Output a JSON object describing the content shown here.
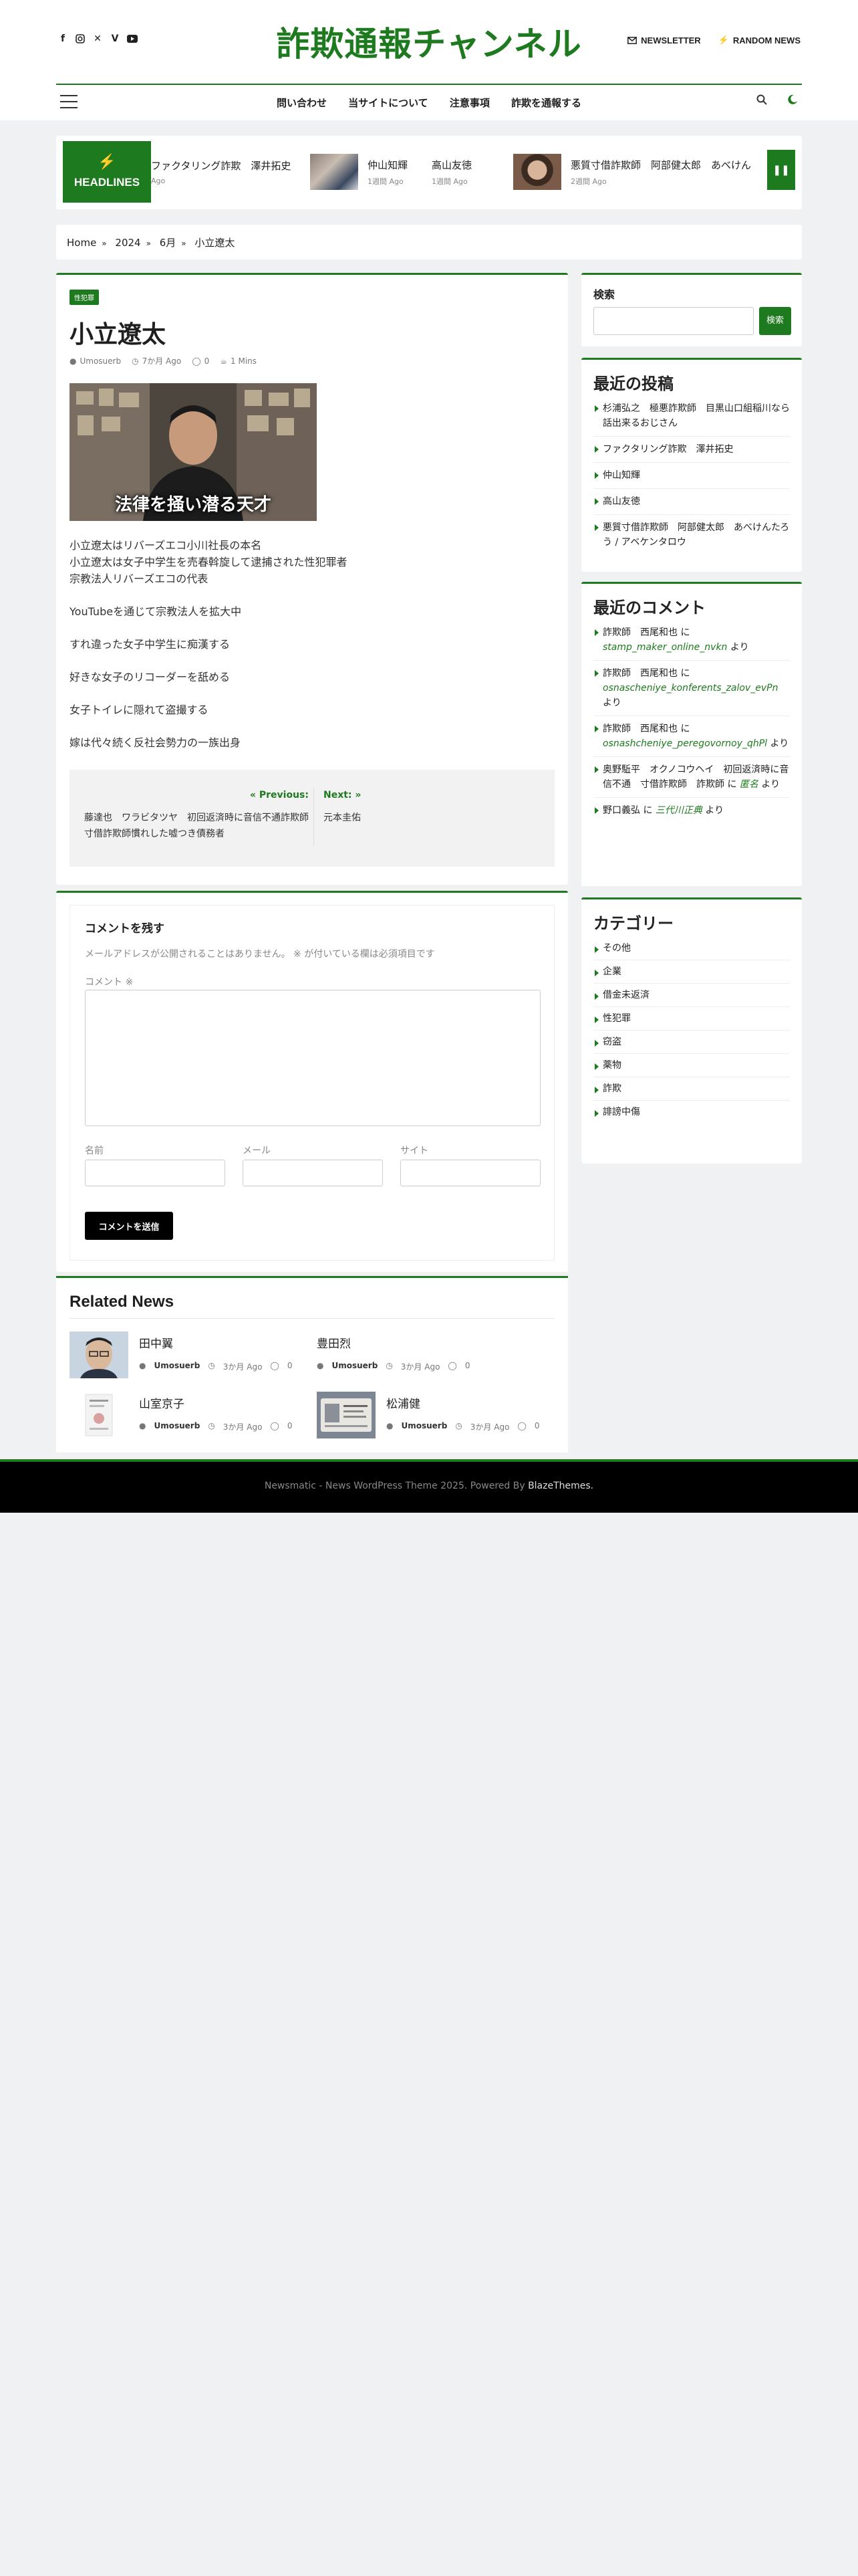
{
  "header": {
    "site_title": "詐欺通報チャンネル",
    "newsletter": "NEWSLETTER",
    "random_news": "RANDOM NEWS"
  },
  "nav": {
    "items": [
      "問い合わせ",
      "当サイトについて",
      "注意事項",
      "詐欺を通報する"
    ]
  },
  "ticker": {
    "label": "HEADLINES",
    "items": [
      {
        "title": "ファクタリング詐欺　澤井拓史",
        "date": "Ago"
      },
      {
        "title": "仲山知輝",
        "date": "1週間 Ago"
      },
      {
        "title": "高山友徳",
        "date": "1週間 Ago"
      },
      {
        "title": "悪質寸借詐欺師　阿部健太郎　あべけん",
        "date": "2週間 Ago"
      }
    ]
  },
  "breadcrumb": [
    "Home",
    "2024",
    "6月",
    "小立遼太"
  ],
  "article": {
    "category": "性犯罪",
    "title": "小立遼太",
    "author": "Umosuerb",
    "date": "7か月 Ago",
    "comments": "0",
    "read": "1 Mins",
    "image_caption": "法律を掻い潜る天才",
    "paragraphs": [
      "小立遼太はリバーズエコ小川社長の本名",
      "小立遼太は女子中学生を売春斡旋して逮捕された性犯罪者",
      "宗教法人リバーズエコの代表",
      "YouTubeを通じて宗教法人を拡大中",
      "すれ違った女子中学生に痴漢する",
      "好きな女子のリコーダーを舐める",
      "女子トイレに隠れて盗撮する",
      "嫁は代々続く反社会勢力の一族出身"
    ],
    "prev_label": "Previous:",
    "prev_title": "藤達也　ワラビタツヤ　初回返済時に音信不通詐欺師　寸借詐欺師慣れした嘘つき債務者",
    "next_label": "Next:",
    "next_title": "元本圭佑"
  },
  "comment_form": {
    "heading": "コメントを残す",
    "note": "メールアドレスが公開されることはありません。 ※ が付いている欄は必須項目です",
    "comment_label": "コメント ※",
    "name_label": "名前",
    "email_label": "メール",
    "site_label": "サイト",
    "submit": "コメントを送信"
  },
  "related": {
    "heading": "Related News",
    "items": [
      {
        "title": "田中翼",
        "author": "Umosuerb",
        "date": "3か月 Ago",
        "comments": "0"
      },
      {
        "title": "豊田烈",
        "author": "Umosuerb",
        "date": "3か月 Ago",
        "comments": "0"
      },
      {
        "title": "山室京子",
        "author": "Umosuerb",
        "date": "3か月 Ago",
        "comments": "0"
      },
      {
        "title": "松浦健",
        "author": "Umosuerb",
        "date": "3か月 Ago",
        "comments": "0"
      }
    ]
  },
  "sidebar": {
    "search_heading": "検索",
    "search_button": "検索",
    "recent_posts_heading": "最近の投稿",
    "recent_posts": [
      "杉浦弘之　極悪詐欺師　目黒山口組稲川なら話出来るおじさん",
      "ファクタリング詐欺　澤井拓史",
      "仲山知輝",
      "高山友徳",
      "悪質寸借詐欺師　阿部健太郎　あべけんたろう / アベケンタロウ"
    ],
    "recent_comments_heading": "最近のコメント",
    "recent_comments": [
      {
        "author": "詐欺師　西尾和也",
        "on": " に ",
        "link": "stamp_maker_online_nvkn",
        "tail": " より"
      },
      {
        "author": "詐欺師　西尾和也",
        "on": " に ",
        "link": "osnascheniye_konferents_zalov_evPn",
        "tail": " より"
      },
      {
        "author": "詐欺師　西尾和也",
        "on": " に ",
        "link": "osnashcheniye_peregovornoy_qhPl",
        "tail": " より"
      },
      {
        "author": "奥野駈平　オクノコウヘイ　初回返済時に音信不通　寸借詐欺師　詐欺師",
        "on": " に ",
        "link": "匿名",
        "tail": " より"
      },
      {
        "author": "野口義弘",
        "on": " に ",
        "link": "三代川正典",
        "tail": " より"
      }
    ],
    "categories_heading": "カテゴリー",
    "categories": [
      "その他",
      "企業",
      "借金未返済",
      "性犯罪",
      "窃盗",
      "薬物",
      "詐欺",
      "誹謗中傷"
    ]
  },
  "footer": {
    "text": "Newsmatic - News WordPress Theme 2025. Powered By ",
    "brand": "BlazeThemes."
  },
  "colors": {
    "accent": "#1e7a1e",
    "footer_bg": "#000000",
    "page_bg": "#f0f1f3"
  }
}
